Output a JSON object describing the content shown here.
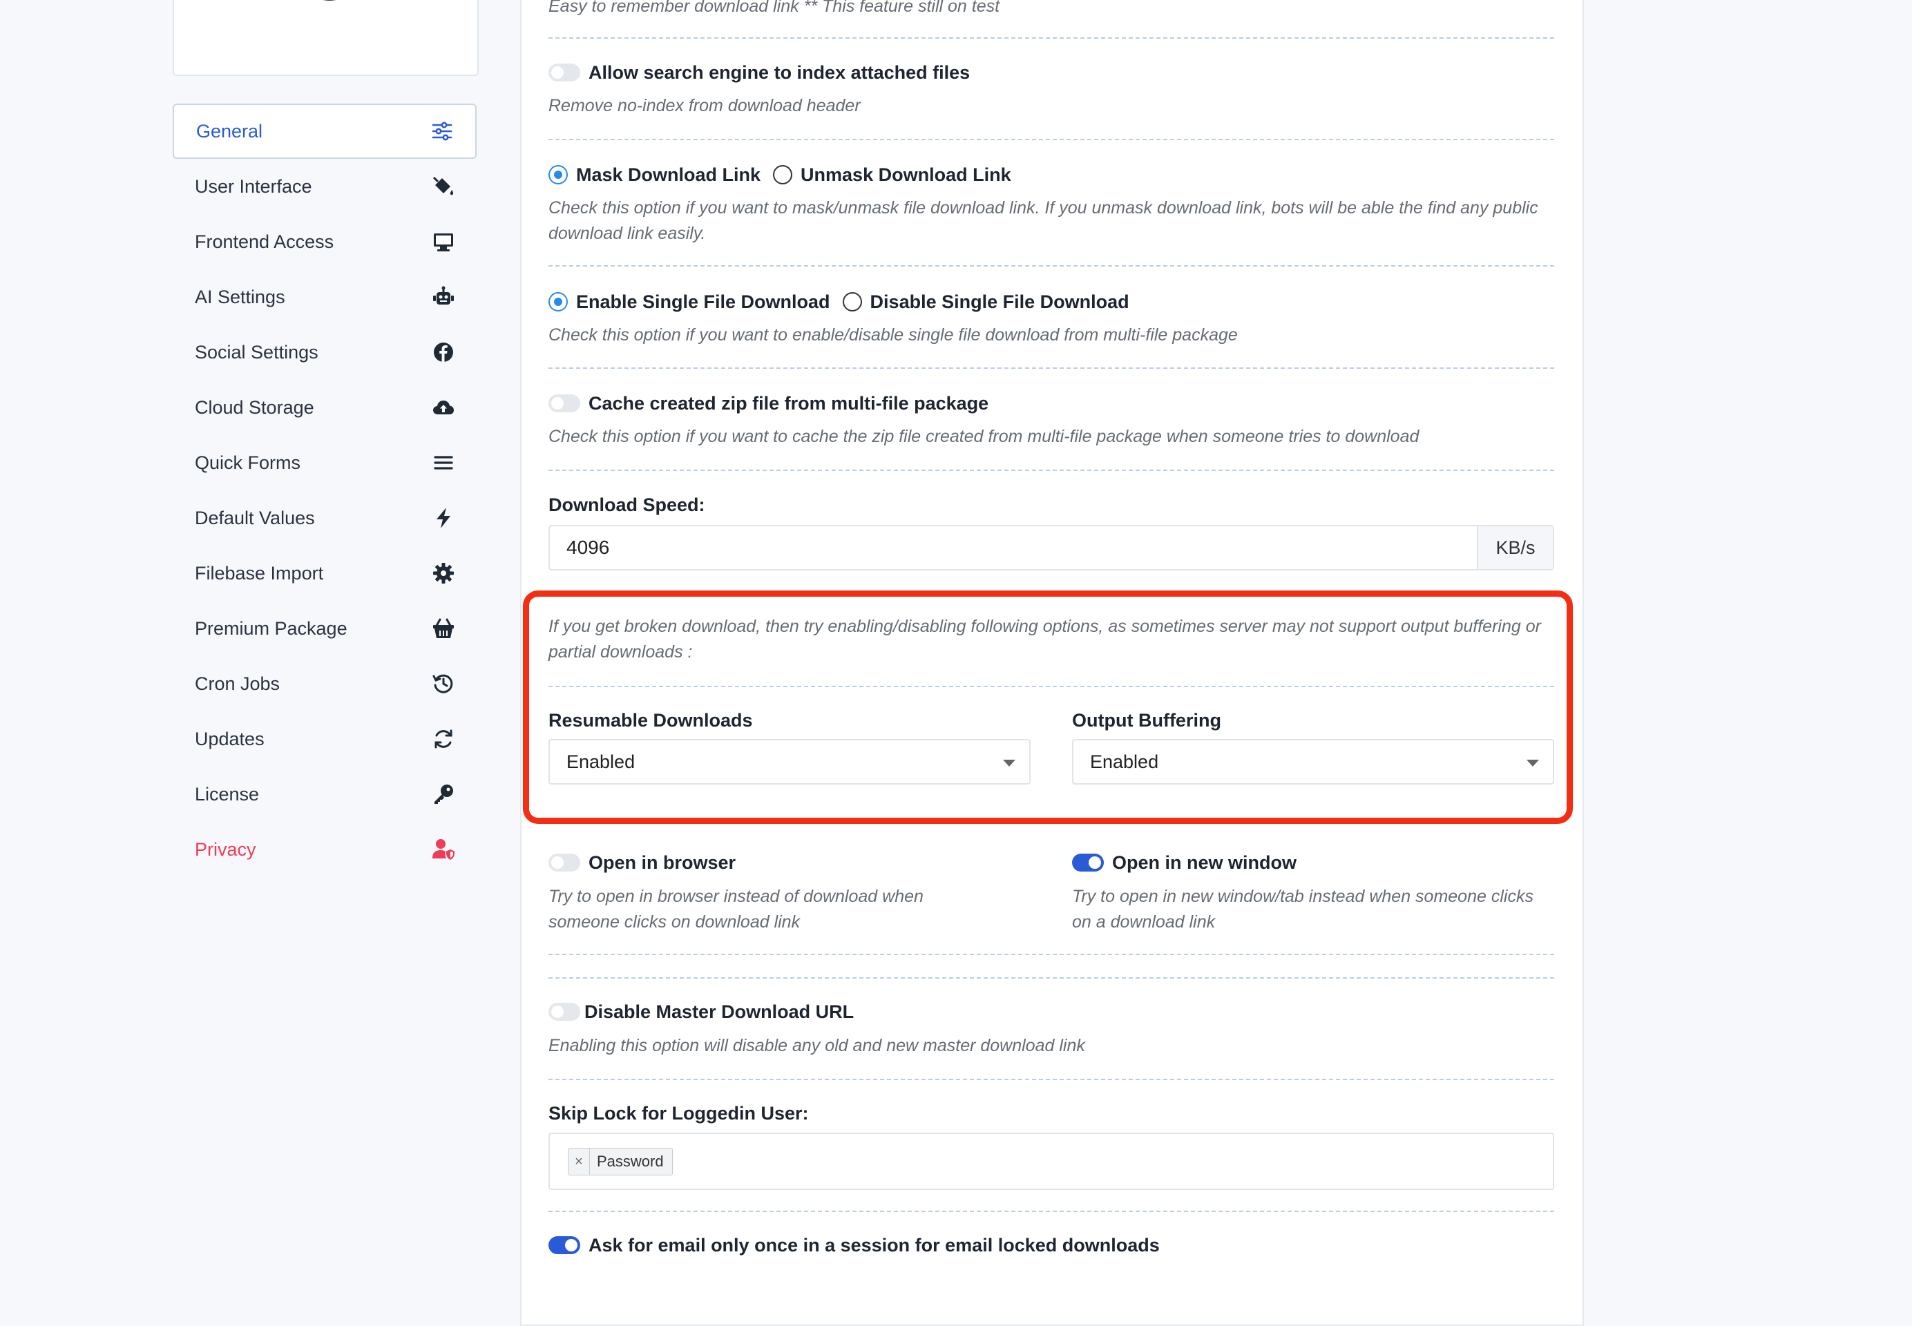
{
  "sidebar": {
    "items": [
      {
        "label": "General",
        "icon": "sliders-icon"
      },
      {
        "label": "User Interface",
        "icon": "paint-bucket-icon"
      },
      {
        "label": "Frontend Access",
        "icon": "desktop-icon"
      },
      {
        "label": "AI Settings",
        "icon": "robot-icon"
      },
      {
        "label": "Social Settings",
        "icon": "facebook-icon"
      },
      {
        "label": "Cloud Storage",
        "icon": "cloud-upload-icon"
      },
      {
        "label": "Quick Forms",
        "icon": "bars-icon"
      },
      {
        "label": "Default Values",
        "icon": "bolt-icon"
      },
      {
        "label": "Filebase Import",
        "icon": "gear-icon"
      },
      {
        "label": "Premium Package",
        "icon": "basket-icon"
      },
      {
        "label": "Cron Jobs",
        "icon": "history-icon"
      },
      {
        "label": "Updates",
        "icon": "sync-icon"
      },
      {
        "label": "License",
        "icon": "key-icon"
      },
      {
        "label": "Privacy",
        "icon": "user-shield-icon"
      }
    ]
  },
  "settings": {
    "top_note": "Easy to remember download link ** This feature still on test",
    "index_files": {
      "label": "Allow search engine to index attached files",
      "note": "Remove no-index from download header",
      "enabled": false
    },
    "mask": {
      "mask_label": "Mask Download Link",
      "unmask_label": "Unmask Download Link",
      "note": "Check this option if you want to mask/unmask file download link. If you unmask download link, bots will be able the find any public download link easily.",
      "selected": "mask"
    },
    "single_file": {
      "enable_label": "Enable Single File Download",
      "disable_label": "Disable Single File Download",
      "note": "Check this option if you want to enable/disable single file download from multi-file package",
      "selected": "enable"
    },
    "cache_zip": {
      "label": "Cache created zip file from multi-file package",
      "note": "Check this option if you want to cache the zip file created from multi-file package when someone tries to download",
      "enabled": false
    },
    "download_speed": {
      "label": "Download Speed:",
      "value": "4096",
      "unit": "KB/s"
    },
    "broken_note": "If you get broken download, then try enabling/disabling following options, as sometimes server may not support output buffering or partial downloads :",
    "resumable": {
      "label": "Resumable Downloads",
      "value": "Enabled"
    },
    "output_buffering": {
      "label": "Output Buffering",
      "value": "Enabled"
    },
    "open_browser": {
      "label": "Open in browser",
      "note": "Try to open in browser instead of download when someone clicks on download link",
      "enabled": false
    },
    "open_new_window": {
      "label": "Open in new window",
      "note": "Try to open in new window/tab instead when someone clicks on a download link",
      "enabled": true
    },
    "disable_master": {
      "label": "Disable Master Download URL",
      "note": "Enabling this option will disable any old and new master download link",
      "enabled": false
    },
    "skip_lock": {
      "label": "Skip Lock for Loggedin User:",
      "tags": [
        "Password"
      ],
      "remove_glyph": "×"
    },
    "ask_email": {
      "label": "Ask for email only once in a session for email locked downloads",
      "enabled": true
    }
  },
  "colors": {
    "accent": "#2a5bd7",
    "danger": "#ef3d56",
    "highlight": "#f42e15"
  }
}
